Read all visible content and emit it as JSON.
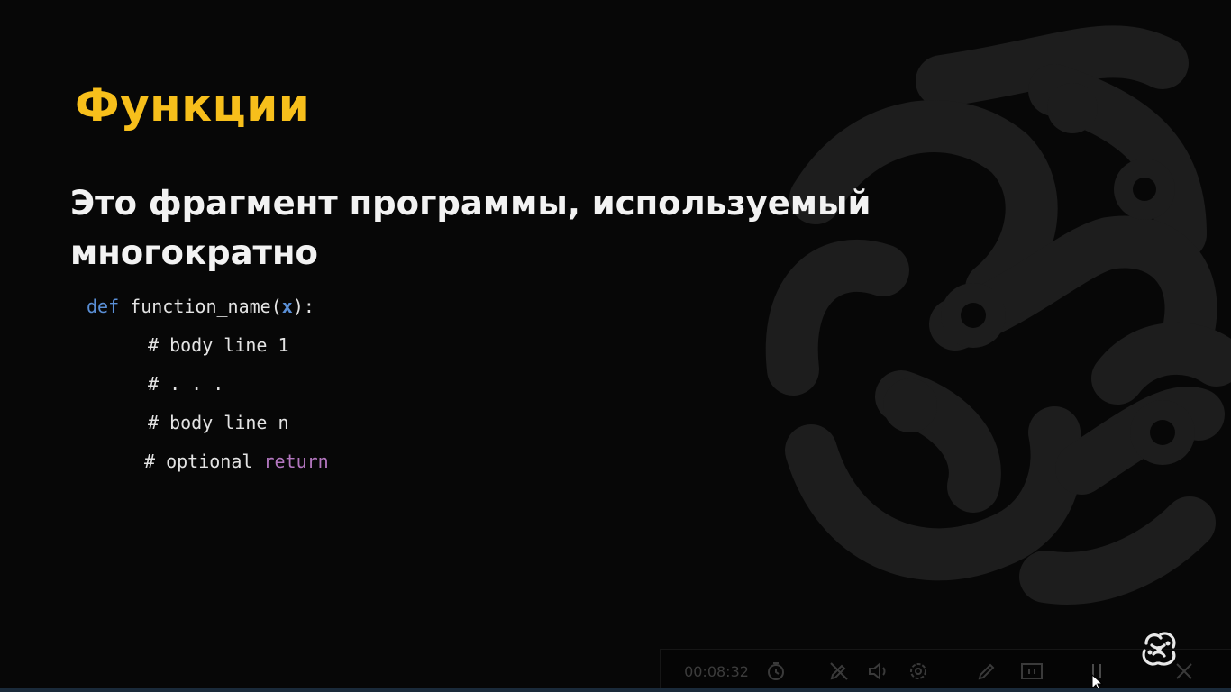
{
  "slide": {
    "title": "Функции",
    "subtitle": "Это фрагмент программы, используемый многократно",
    "code": {
      "def_keyword": "def",
      "function_name": "function_name",
      "open_paren": "(",
      "param": "x",
      "close_paren_colon": "):",
      "body_line_1": "# body line 1",
      "ellipsis_line": "# . . .",
      "body_line_n": "# body line n",
      "optional_prefix": "# optional ",
      "return_keyword": "return"
    }
  },
  "toolbar": {
    "timer": "00:08:32",
    "icons": [
      "timer-icon",
      "pen-off-icon",
      "speaker-icon",
      "settings-icon",
      "pencil-icon",
      "screen-icon",
      "stop-icon",
      "close-icon"
    ]
  },
  "colors": {
    "background": "#070707",
    "title": "#f7bf1b",
    "subtitle": "#f2f2f2",
    "keyword": "#5a8fd6",
    "return_keyword": "#b477c0"
  }
}
